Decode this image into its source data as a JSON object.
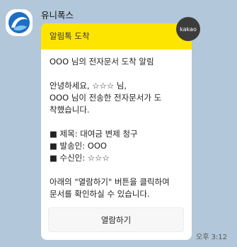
{
  "sender": {
    "name": "유니폭스",
    "avatar_icon": "unipox-logo-icon"
  },
  "message": {
    "header": "알림톡 도착",
    "badge": "kakao",
    "lines": [
      "OOO 님의 전자문서 도착 알림",
      "",
      "안녕하세요, ☆☆☆ 님,",
      "OOO 님이 전송한 전자문서가 도",
      "착했습니다.",
      "",
      "■ 제목: 대여금 변제 청구",
      "■ 발송인: OOO",
      "■ 수신인: ☆☆☆",
      "",
      "아래의 \"열람하기\" 버튼을 클릭하여",
      "문서를 확인하실 수 있습니다."
    ],
    "button_label": "열람하기",
    "time": "오후 3:12"
  }
}
